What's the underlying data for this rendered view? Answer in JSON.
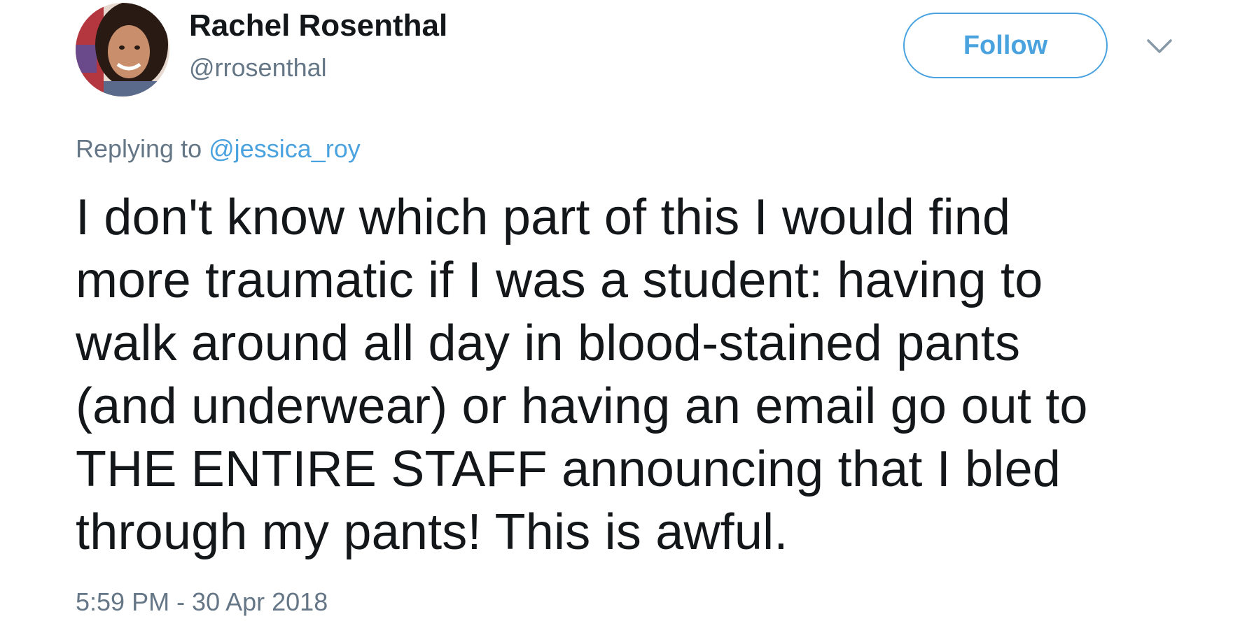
{
  "author": {
    "name": "Rachel Rosenthal",
    "handle": "@rrosenthal",
    "avatar_icon": "user-photo-avatar"
  },
  "follow_button": {
    "label": "Follow",
    "color": "#4aa3df"
  },
  "menu_icon": "chevron-down-icon",
  "reply": {
    "prefix": "Replying to",
    "mention": "@jessica_roy"
  },
  "tweet": {
    "lines": [
      "I don't know which part of this I would find",
      "more traumatic if I was a student: having to",
      "walk around all day in blood-stained pants",
      "(and underwear) or having an email go out to",
      "THE ENTIRE STAFF announcing that I bled",
      "through my pants! This is awful."
    ]
  },
  "timestamp": "5:59 PM - 30 Apr 2018",
  "colors": {
    "text_primary": "#14171a",
    "text_secondary": "#657786",
    "accent": "#4aa3df"
  }
}
